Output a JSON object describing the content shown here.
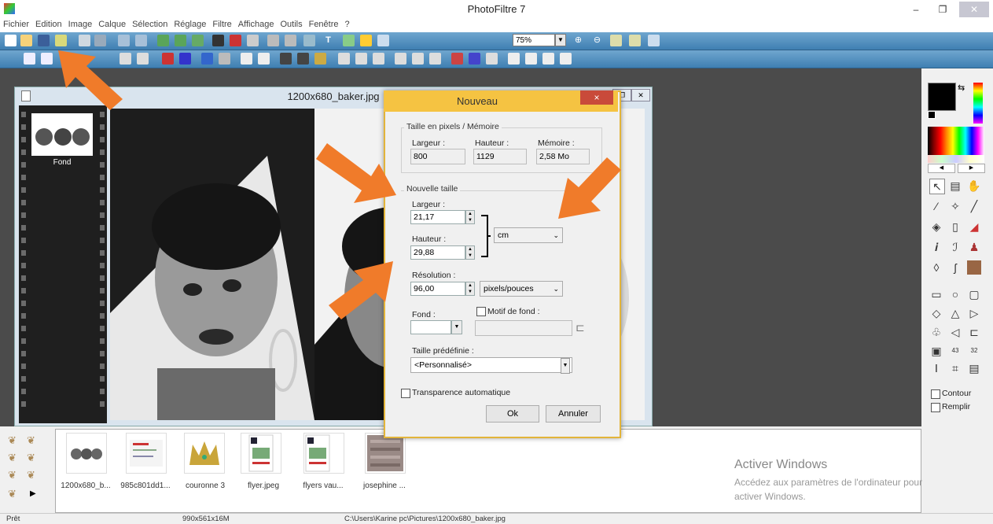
{
  "app": {
    "title": "PhotoFiltre 7"
  },
  "menu": [
    "Fichier",
    "Edition",
    "Image",
    "Calque",
    "Sélection",
    "Réglage",
    "Filtre",
    "Affichage",
    "Outils",
    "Fenêtre",
    "?"
  ],
  "toolbar": {
    "zoom": "75%"
  },
  "image_window": {
    "title": "1200x680_baker.jpg",
    "layer_label": "Fond"
  },
  "dialog": {
    "title": "Nouveau",
    "close": "×",
    "size_group": "Taille en pixels / Mémoire",
    "largeur_label": "Largeur :",
    "hauteur_label": "Hauteur :",
    "memoire_label": "Mémoire :",
    "largeur_px": "800",
    "hauteur_px": "1129",
    "memoire": "2,58 Mo",
    "new_size_group": "Nouvelle taille",
    "largeur2_label": "Largeur :",
    "largeur_value": "21,17",
    "hauteur2_label": "Hauteur :",
    "hauteur_value": "29,88",
    "unit": "cm",
    "resolution_label": "Résolution :",
    "resolution_value": "96,00",
    "resolution_unit": "pixels/pouces",
    "fond_label": "Fond :",
    "motif_label": "Motif de fond :",
    "preset_label": "Taille prédéfinie :",
    "preset_value": "<Personnalisé>",
    "transparence_label": "Transparence automatique",
    "ok": "Ok",
    "cancel": "Annuler"
  },
  "right_panel": {
    "contour": "Contour",
    "remplir": "Remplir"
  },
  "browser": {
    "files": [
      "1200x680_b...",
      "985c801dd1...",
      "couronne 3",
      "flyer.jpeg",
      "flyers vau...",
      "josephine ..."
    ]
  },
  "watermark": {
    "line1": "Activer Windows",
    "line2": "Accédez aux paramètres de l'ordinateur pour",
    "line3": "activer Windows."
  },
  "status": {
    "state": "Prêt",
    "dims": "990x561x16M",
    "path": "C:\\Users\\Karine pc\\Pictures\\1200x680_baker.jpg"
  },
  "colors": {
    "toolbar": "#4f8fc2",
    "dialog_title": "#f5c342",
    "arrow": "#f07b2a",
    "close": "#c94a3a"
  }
}
